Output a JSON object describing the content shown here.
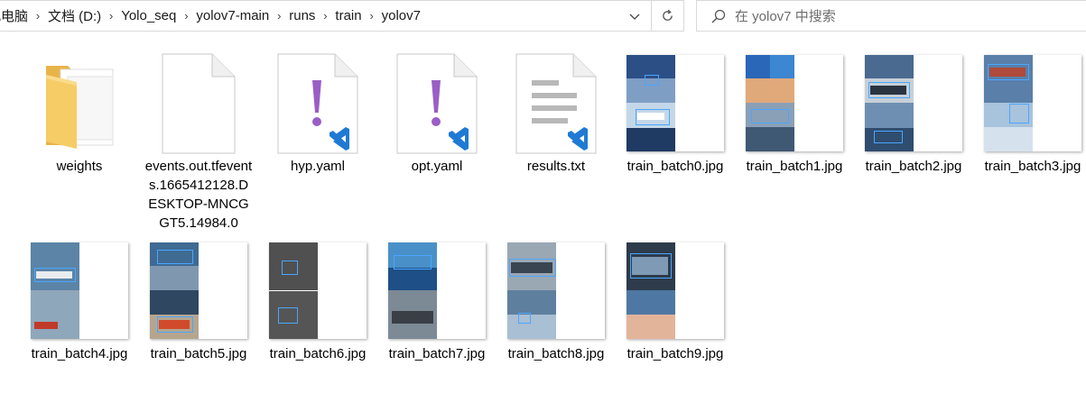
{
  "address_bar": {
    "crumbs": [
      "此电脑",
      "文档 (D:)",
      "Yolo_seq",
      "yolov7-main",
      "runs",
      "train",
      "yolov7"
    ],
    "separator_icon": "chevron-right-icon",
    "dropdown_icon": "chevron-down-icon"
  },
  "refresh": {
    "icon": "refresh-icon"
  },
  "search": {
    "placeholder": "在 yolov7 中搜索",
    "icon": "search-icon"
  },
  "colors": {
    "folder": "#f2c55c",
    "vscode_purple": "#9a5ec5",
    "vscode_blue": "#1f7ad4",
    "border": "#d9d9d9",
    "thumb_box": "#4aa6ff"
  },
  "files": [
    {
      "name": "weights",
      "type": "folder"
    },
    {
      "name": "events.out.tfevents.1665412128.DESKTOP-MNCGGT5.14984.0",
      "type": "generic-file"
    },
    {
      "name": "hyp.yaml",
      "type": "yaml"
    },
    {
      "name": "opt.yaml",
      "type": "yaml"
    },
    {
      "name": "results.txt",
      "type": "txt"
    },
    {
      "name": "train_batch0.jpg",
      "type": "image"
    },
    {
      "name": "train_batch1.jpg",
      "type": "image"
    },
    {
      "name": "train_batch2.jpg",
      "type": "image"
    },
    {
      "name": "train_batch3.jpg",
      "type": "image"
    },
    {
      "name": "train_batch4.jpg",
      "type": "image"
    },
    {
      "name": "train_batch5.jpg",
      "type": "image"
    },
    {
      "name": "train_batch6.jpg",
      "type": "image"
    },
    {
      "name": "train_batch7.jpg",
      "type": "image"
    },
    {
      "name": "train_batch8.jpg",
      "type": "image"
    },
    {
      "name": "train_batch9.jpg",
      "type": "image"
    }
  ]
}
